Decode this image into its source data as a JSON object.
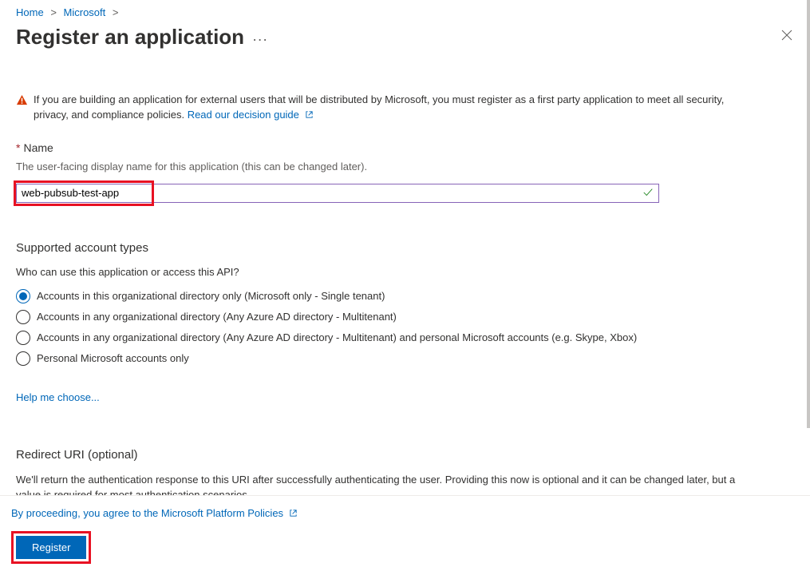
{
  "breadcrumb": {
    "home": "Home",
    "microsoft": "Microsoft"
  },
  "page_title": "Register an application",
  "info_banner": {
    "text_before_link": "If you are building an application for external users that will be distributed by Microsoft, you must register as a first party application to meet all security, privacy, and compliance policies. ",
    "link_text": "Read our decision guide"
  },
  "name_section": {
    "required_star": "*",
    "label": "Name",
    "helper": "The user-facing display name for this application (this can be changed later).",
    "value": "web-pubsub-test-app"
  },
  "account_types": {
    "title": "Supported account types",
    "question": "Who can use this application or access this API?",
    "options": [
      "Accounts in this organizational directory only (Microsoft only - Single tenant)",
      "Accounts in any organizational directory (Any Azure AD directory - Multitenant)",
      "Accounts in any organizational directory (Any Azure AD directory - Multitenant) and personal Microsoft accounts (e.g. Skype, Xbox)",
      "Personal Microsoft accounts only"
    ],
    "selected_index": 0,
    "help_link": "Help me choose..."
  },
  "redirect_uri": {
    "title": "Redirect URI (optional)",
    "description": "We'll return the authentication response to this URI after successfully authenticating the user. Providing this now is optional and it can be changed later, but a value is required for most authentication scenarios."
  },
  "footer": {
    "agree_text": "By proceeding, you agree to the Microsoft Platform Policies",
    "register_label": "Register"
  }
}
